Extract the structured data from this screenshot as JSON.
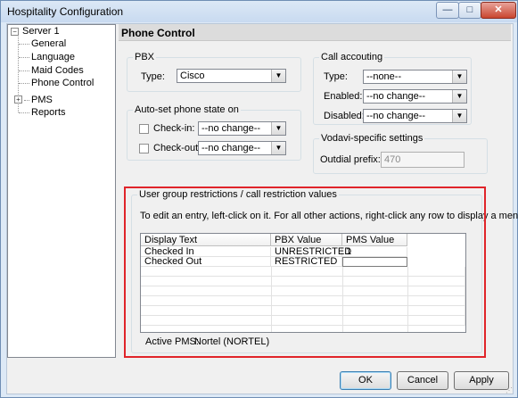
{
  "window": {
    "title": "Hospitality Configuration",
    "min_label": "—",
    "max_label": "□",
    "close_label": "✕"
  },
  "tree": {
    "root": {
      "expander": "−",
      "label": "Server 1"
    },
    "items": [
      {
        "label": "General"
      },
      {
        "label": "Language"
      },
      {
        "label": "Maid Codes"
      },
      {
        "label": "Phone Control"
      },
      {
        "label": "PMS",
        "expander": "+"
      },
      {
        "label": "Reports"
      }
    ]
  },
  "panel": {
    "title": "Phone Control"
  },
  "pbx": {
    "legend": "PBX",
    "type_label": "Type:",
    "type_value": "Cisco"
  },
  "call_accounting": {
    "legend": "Call accouting",
    "type_label": "Type:",
    "type_value": "--none--",
    "enabled_label": "Enabled:",
    "enabled_value": "--no change--",
    "disabled_label": "Disabled:",
    "disabled_value": "--no change--"
  },
  "auto_set": {
    "legend": "Auto-set phone state on",
    "checkin_label": "Check-in:",
    "checkin_value": "--no change--",
    "checkout_label": "Check-out:",
    "checkout_value": "--no change--"
  },
  "vodavi": {
    "legend": "Vodavi-specific settings",
    "outdial_label": "Outdial prefix:",
    "outdial_value": "470"
  },
  "restrictions": {
    "legend": "User group restrictions / call restriction values",
    "instructions": "To edit an entry, left-click on it.  For all other actions, right-click any row to display a menu.",
    "columns": [
      "Display Text",
      "PBX Value",
      "PMS Value"
    ],
    "rows": [
      {
        "display": "Checked In",
        "pbx": "UNRESTRICTED",
        "pms": "1"
      },
      {
        "display": "Checked Out",
        "pbx": "RESTRICTED",
        "pms": ""
      }
    ],
    "active_pms_label": "Active PMS:",
    "active_pms_value": "Nortel (NORTEL)"
  },
  "buttons": {
    "ok": "OK",
    "cancel": "Cancel",
    "apply": "Apply"
  },
  "colors": {
    "highlight_border": "#e0242a",
    "title_gradient_top": "#dce8f6"
  }
}
